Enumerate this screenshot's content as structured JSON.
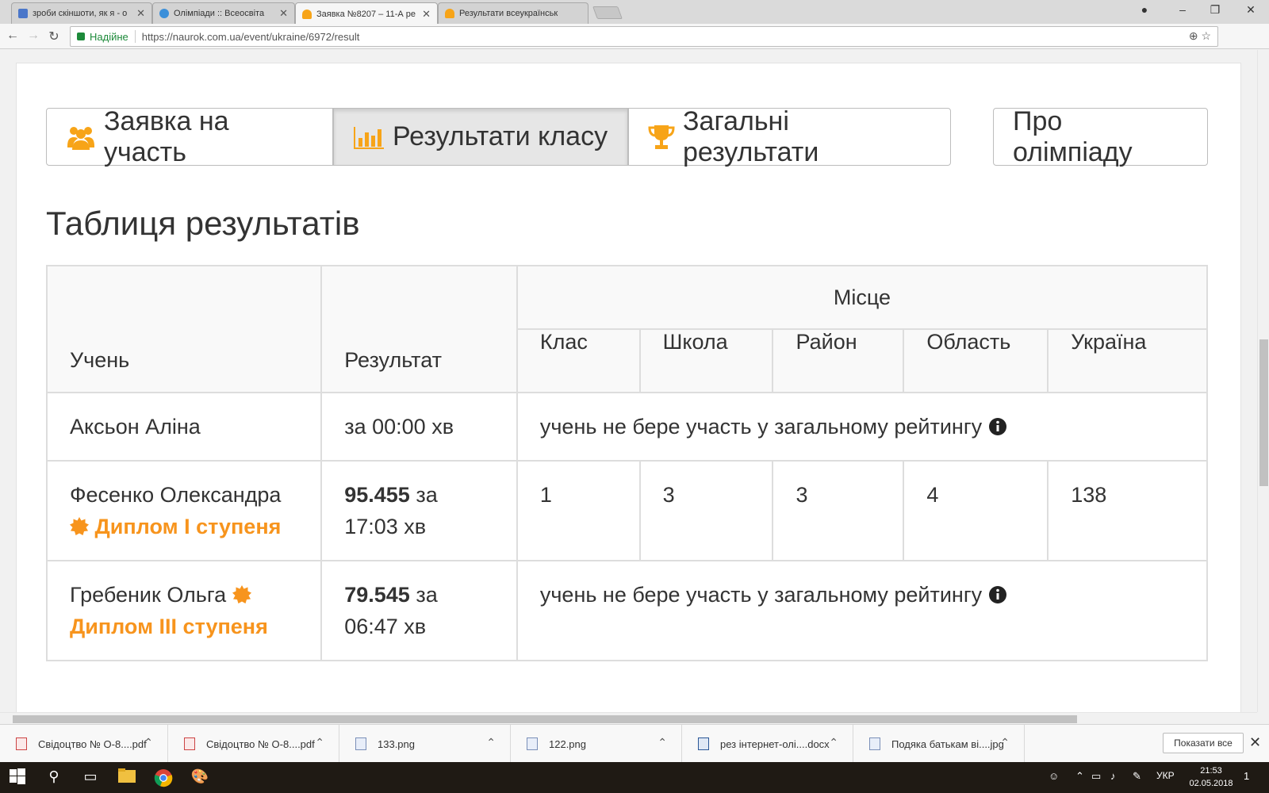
{
  "browser": {
    "tabs": [
      {
        "label": "зроби скіншоти, як я - о",
        "favicon_color": "#4a76c9"
      },
      {
        "label": "Олімпіади :: Всеосвіта",
        "favicon_color": "#3b8fd9"
      },
      {
        "label": "Заявка №8207 – 11-А ре",
        "favicon_color": "#f7a418"
      },
      {
        "label": "Результати всеукраїнськ",
        "favicon_color": "#f7a418"
      }
    ],
    "close_glyph": "✕",
    "secure_label": "Надійне",
    "url": "https://naurok.com.ua/event/ukraine/6972/result"
  },
  "page": {
    "buttons": {
      "application": "Заявка на участь",
      "class_results": "Результати класу",
      "overall_results": "Загальні результати",
      "about": "Про олімпіаду"
    },
    "section_title": "Таблиця результатів",
    "table": {
      "headers": {
        "student": "Учень",
        "result": "Результат",
        "place": "Місце",
        "class": "Клас",
        "school": "Школа",
        "district": "Район",
        "region": "Область",
        "ukraine": "Україна"
      },
      "rows": [
        {
          "name": "Аксьон Аліна",
          "time_text": "за 00:00 хв",
          "note": "учень не бере участь у загальному рейтингу"
        },
        {
          "name": "Фесенко Олександра",
          "diploma": "Диплом І ступеня",
          "score": "95.455",
          "time_prefix": "за",
          "time": "17:03 хв",
          "places": {
            "class": "1",
            "school": "3",
            "district": "3",
            "region": "4",
            "ukraine": "138"
          }
        },
        {
          "name": "Гребеник Ольга",
          "diploma": "Диплом ІІІ ступеня",
          "score": "79.545",
          "time_prefix": "за",
          "time": "06:47 хв",
          "note": "учень не бере участь у загальному рейтингу"
        }
      ]
    },
    "accent_color": "#f7941d"
  },
  "downloads": {
    "items": [
      {
        "name": "Свідоцтво № О-8....pdf",
        "type": "pdf"
      },
      {
        "name": "Свідоцтво № О-8....pdf",
        "type": "pdf"
      },
      {
        "name": "133.png",
        "type": "image"
      },
      {
        "name": "122.png",
        "type": "image"
      },
      {
        "name": "рез інтернет-олі....docx",
        "type": "doc"
      },
      {
        "name": "Подяка батькам ві....jpg",
        "type": "image"
      }
    ],
    "show_all": "Показати все"
  },
  "taskbar": {
    "language": "УКР",
    "time": "21:53",
    "date": "02.05.2018",
    "notification_count": "1"
  }
}
